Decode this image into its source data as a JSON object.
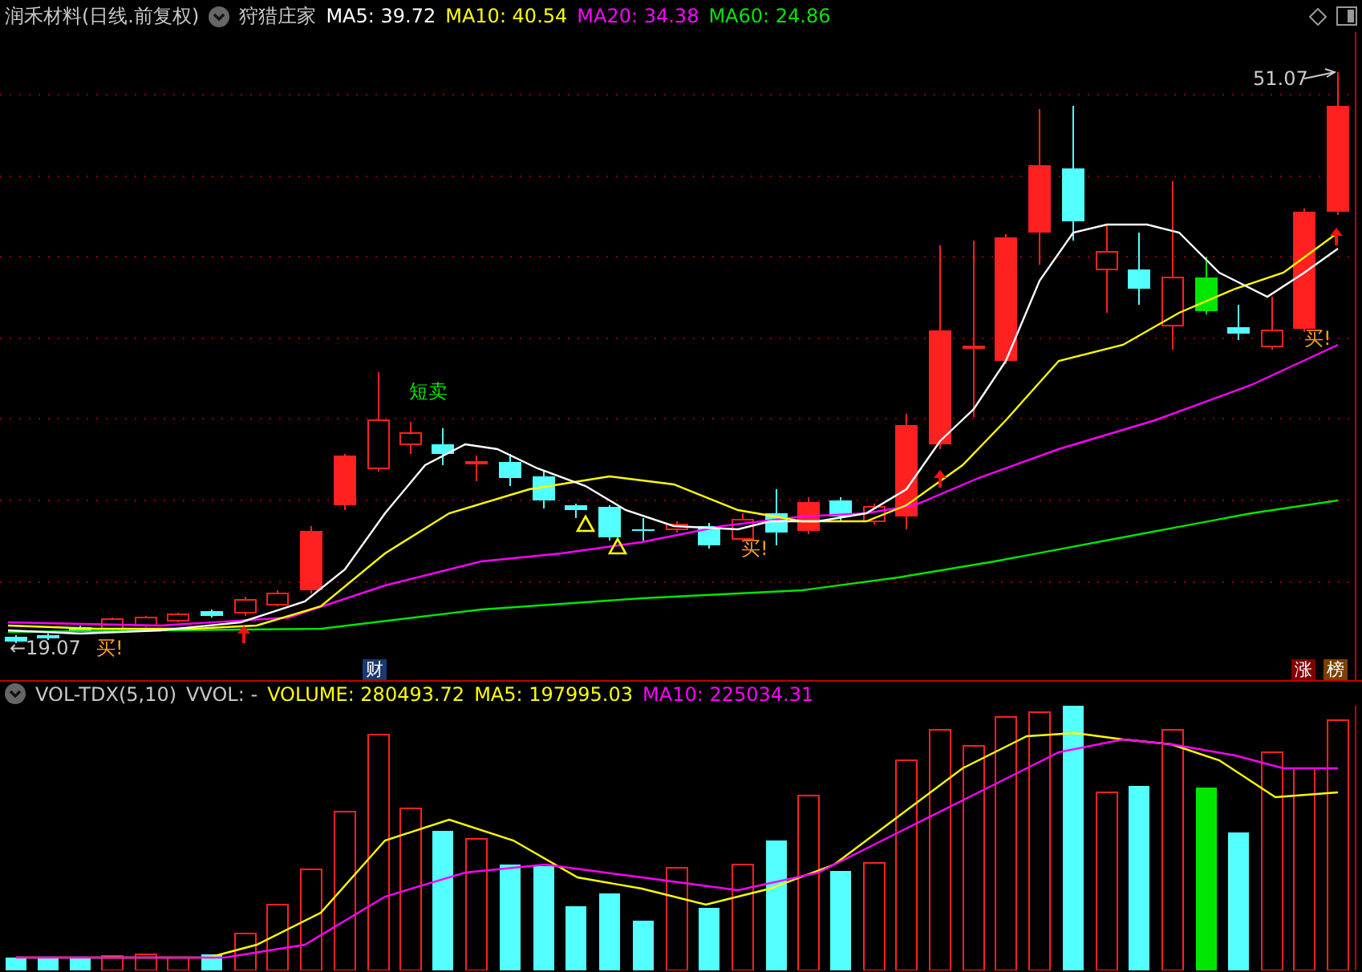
{
  "header": {
    "title": "润禾材料(日线.前复权)",
    "indicator": "狩猎庄家",
    "ma_readings": [
      {
        "label": "MA5: 39.72",
        "color": "#ffffff"
      },
      {
        "label": "MA10: 40.54",
        "color": "#ffff00"
      },
      {
        "label": "MA20: 34.38",
        "color": "#ff00ff"
      },
      {
        "label": "MA60: 24.86",
        "color": "#00e600"
      }
    ]
  },
  "price_chart": {
    "high_label": "51.07",
    "low_label": "←19.07",
    "signals": [
      {
        "kind": "sell",
        "text": "短卖"
      },
      {
        "kind": "buy",
        "text": "买!"
      },
      {
        "kind": "buy",
        "text": "买!"
      },
      {
        "kind": "buy",
        "text": "买!"
      }
    ],
    "badges": [
      {
        "kind": "news",
        "text": "财"
      },
      {
        "kind": "rise",
        "text": "涨"
      },
      {
        "kind": "rank",
        "text": "榜"
      }
    ]
  },
  "volume_panel": {
    "name": "VOL-TDX(5,10)",
    "readings": [
      {
        "label": "VVOL: -",
        "color": "#c8c8c8"
      },
      {
        "label": "VOLUME: 280493.72",
        "color": "#ffff00"
      },
      {
        "label": "MA5: 197995.03",
        "color": "#ffff00"
      },
      {
        "label": "MA10: 225034.31",
        "color": "#ff00ff"
      }
    ]
  }
}
